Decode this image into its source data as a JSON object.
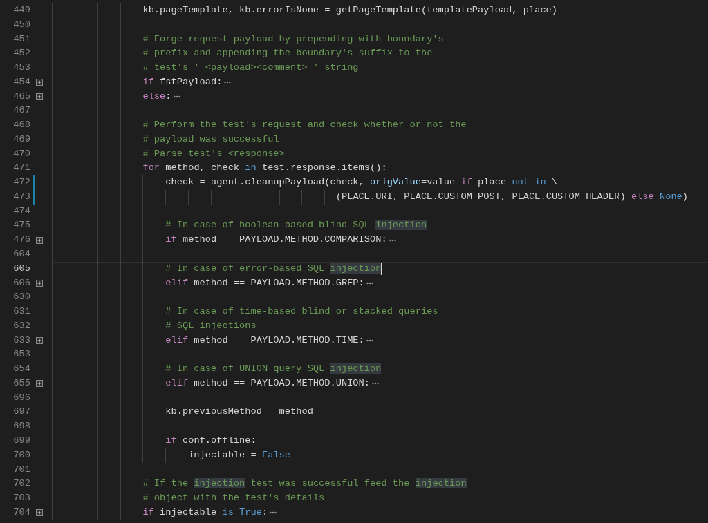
{
  "editor": {
    "lines": [
      {
        "number": "449",
        "tokens": [
          {
            "text": "                kb.pageTemplate, kb.errorIsNone = getPageTemplate(templatePayload, place)",
            "kind": "plain"
          }
        ]
      },
      {
        "number": "450"
      },
      {
        "number": "451",
        "tokens": [
          {
            "text": "                # Forge request payload by prepending with boundary's",
            "kind": "comment"
          }
        ]
      },
      {
        "number": "452",
        "tokens": [
          {
            "text": "                # prefix and appending the boundary's suffix to the",
            "kind": "comment"
          }
        ]
      },
      {
        "number": "453",
        "tokens": [
          {
            "text": "                # test's ' <payload><comment> ' string",
            "kind": "comment"
          }
        ]
      },
      {
        "number": "454",
        "folded": true,
        "tokens": [
          {
            "text": "                if",
            "kind": "keyword"
          },
          {
            "text": " fstPayload:",
            "kind": "plain"
          }
        ]
      },
      {
        "number": "465",
        "folded": true,
        "tokens": [
          {
            "text": "                else",
            "kind": "keyword"
          },
          {
            "text": ":",
            "kind": "plain"
          }
        ]
      },
      {
        "number": "467"
      },
      {
        "number": "468",
        "tokens": [
          {
            "text": "                # Perform the test's request and check whether or not the",
            "kind": "comment"
          }
        ]
      },
      {
        "number": "469",
        "tokens": [
          {
            "text": "                # payload was successful",
            "kind": "comment"
          }
        ]
      },
      {
        "number": "470",
        "tokens": [
          {
            "text": "                # Parse test's <response>",
            "kind": "comment"
          }
        ]
      },
      {
        "number": "471",
        "tokens": [
          {
            "text": "                for",
            "kind": "keyword"
          },
          {
            "text": " method, check ",
            "kind": "plain"
          },
          {
            "text": "in",
            "kind": "constant"
          },
          {
            "text": " test.response.items():",
            "kind": "plain"
          }
        ]
      },
      {
        "number": "472",
        "modified": true,
        "tokens": [
          {
            "text": "                    check = agent.cleanupPayload(check, ",
            "kind": "plain"
          },
          {
            "text": "origValue",
            "kind": "parameter"
          },
          {
            "text": "=value ",
            "kind": "plain"
          },
          {
            "text": "if",
            "kind": "keyword"
          },
          {
            "text": " place ",
            "kind": "plain"
          },
          {
            "text": "not in",
            "kind": "constant"
          },
          {
            "text": " \\",
            "kind": "plain"
          }
        ]
      },
      {
        "number": "473",
        "modified": true,
        "tokens": [
          {
            "text": "                                                  (PLACE.URI, PLACE.CUSTOM_POST, PLACE.CUSTOM_HEADER) ",
            "kind": "plain"
          },
          {
            "text": "else",
            "kind": "keyword"
          },
          {
            "text": " None",
            "kind": "constant"
          },
          {
            "text": ")",
            "kind": "plain"
          }
        ]
      },
      {
        "number": "474"
      },
      {
        "number": "475",
        "tokens": [
          {
            "text": "                    # In case of boolean-based blind SQL ",
            "kind": "comment"
          },
          {
            "text": "injection",
            "kind": "comment",
            "highlighted": true
          }
        ]
      },
      {
        "number": "476",
        "folded": true,
        "tokens": [
          {
            "text": "                    if",
            "kind": "keyword"
          },
          {
            "text": " method == PAYLOAD.METHOD.COMPARISON:",
            "kind": "plain"
          }
        ]
      },
      {
        "number": "604"
      },
      {
        "number": "605",
        "current": true,
        "tokens": [
          {
            "text": "                    # In case of error-based SQL ",
            "kind": "comment"
          },
          {
            "text": "injection",
            "kind": "comment",
            "highlighted": true
          }
        ]
      },
      {
        "number": "606",
        "folded": true,
        "tokens": [
          {
            "text": "                    elif",
            "kind": "keyword"
          },
          {
            "text": " method == PAYLOAD.METHOD.GREP:",
            "kind": "plain"
          }
        ]
      },
      {
        "number": "630"
      },
      {
        "number": "631",
        "tokens": [
          {
            "text": "                    # In case of time-based blind or stacked queries",
            "kind": "comment"
          }
        ]
      },
      {
        "number": "632",
        "tokens": [
          {
            "text": "                    # SQL injections",
            "kind": "comment"
          }
        ]
      },
      {
        "number": "633",
        "folded": true,
        "tokens": [
          {
            "text": "                    elif",
            "kind": "keyword"
          },
          {
            "text": " method == PAYLOAD.METHOD.TIME:",
            "kind": "plain"
          }
        ]
      },
      {
        "number": "653"
      },
      {
        "number": "654",
        "tokens": [
          {
            "text": "                    # In case of UNION query SQL ",
            "kind": "comment"
          },
          {
            "text": "injection",
            "kind": "comment",
            "highlighted": true
          }
        ]
      },
      {
        "number": "655",
        "folded": true,
        "tokens": [
          {
            "text": "                    elif",
            "kind": "keyword"
          },
          {
            "text": " method == PAYLOAD.METHOD.UNION:",
            "kind": "plain"
          }
        ]
      },
      {
        "number": "696"
      },
      {
        "number": "697",
        "tokens": [
          {
            "text": "                    kb.previousMethod = method",
            "kind": "plain"
          }
        ]
      },
      {
        "number": "698"
      },
      {
        "number": "699",
        "tokens": [
          {
            "text": "                    if",
            "kind": "keyword"
          },
          {
            "text": " conf.offline:",
            "kind": "plain"
          }
        ]
      },
      {
        "number": "700",
        "tokens": [
          {
            "text": "                        injectable = ",
            "kind": "plain"
          },
          {
            "text": "False",
            "kind": "constant"
          }
        ]
      },
      {
        "number": "701"
      },
      {
        "number": "702",
        "tokens": [
          {
            "text": "                # If the ",
            "kind": "comment"
          },
          {
            "text": "injection",
            "kind": "comment",
            "highlighted": true
          },
          {
            "text": " test was successful feed the ",
            "kind": "comment"
          },
          {
            "text": "injection",
            "kind": "comment",
            "highlighted": true
          }
        ]
      },
      {
        "number": "703",
        "tokens": [
          {
            "text": "                # object with the test's details",
            "kind": "comment"
          }
        ]
      },
      {
        "number": "704",
        "folded": true,
        "tokens": [
          {
            "text": "                if",
            "kind": "keyword"
          },
          {
            "text": " injectable ",
            "kind": "plain"
          },
          {
            "text": "is True",
            "kind": "constant"
          },
          {
            "text": ":",
            "kind": "plain"
          }
        ]
      }
    ]
  }
}
